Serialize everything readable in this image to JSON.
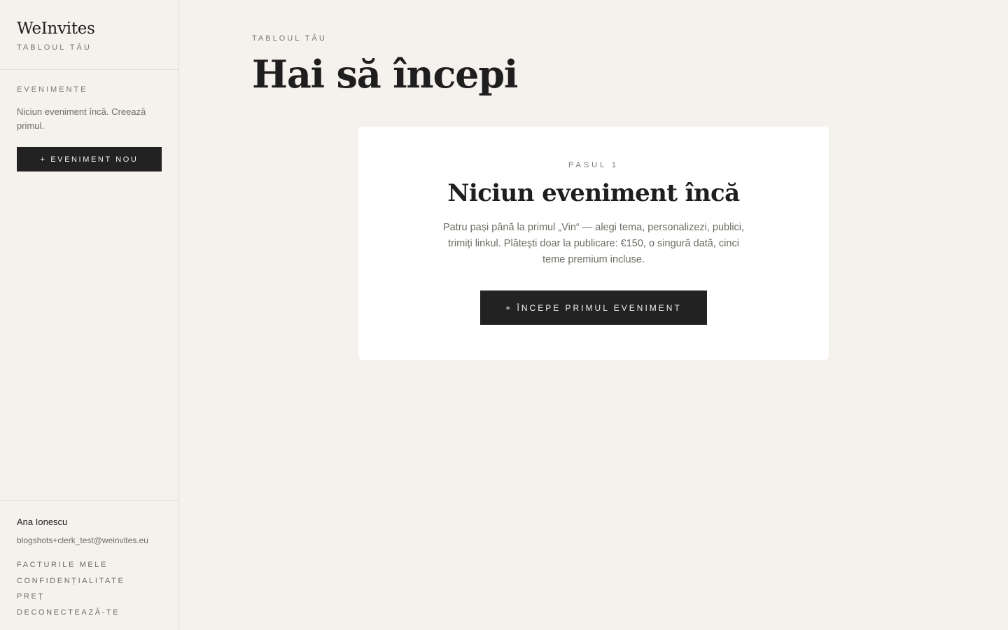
{
  "sidebar": {
    "brand": "WeInvites",
    "brand_subtitle": "TABLOUL TĂU",
    "events_label": "EVENIMENTE",
    "empty_note": "Niciun eveniment încă. Creează primul.",
    "new_event_button": "+ EVENIMENT NOU",
    "user": {
      "name": "Ana Ionescu",
      "email": "blogshots+clerk_test@weinvites.eu"
    },
    "links": [
      {
        "label": "FACTURILE MELE"
      },
      {
        "label": "CONFIDENȚIALITATE"
      },
      {
        "label": "PREȚ"
      },
      {
        "label": "DECONECTEAZĂ-TE"
      }
    ]
  },
  "main": {
    "eyebrow": "TABLOUL TĂU",
    "title": "Hai să începi",
    "card": {
      "step": "PASUL 1",
      "title": "Niciun eveniment încă",
      "description": "Patru pași până la primul „Vin“ — alegi tema, personalizezi, publici, trimiți linkul. Plătești doar la publicare: €150, o singură dată, cinci teme premium incluse.",
      "button": "+ ÎNCEPE PRIMUL EVENIMENT"
    }
  },
  "colors": {
    "background": "#f5f2ee",
    "card": "#ffffff",
    "button": "#222222",
    "text_primary": "#1e1e1e",
    "text_muted": "#6e6a64",
    "border": "#dedad4"
  }
}
